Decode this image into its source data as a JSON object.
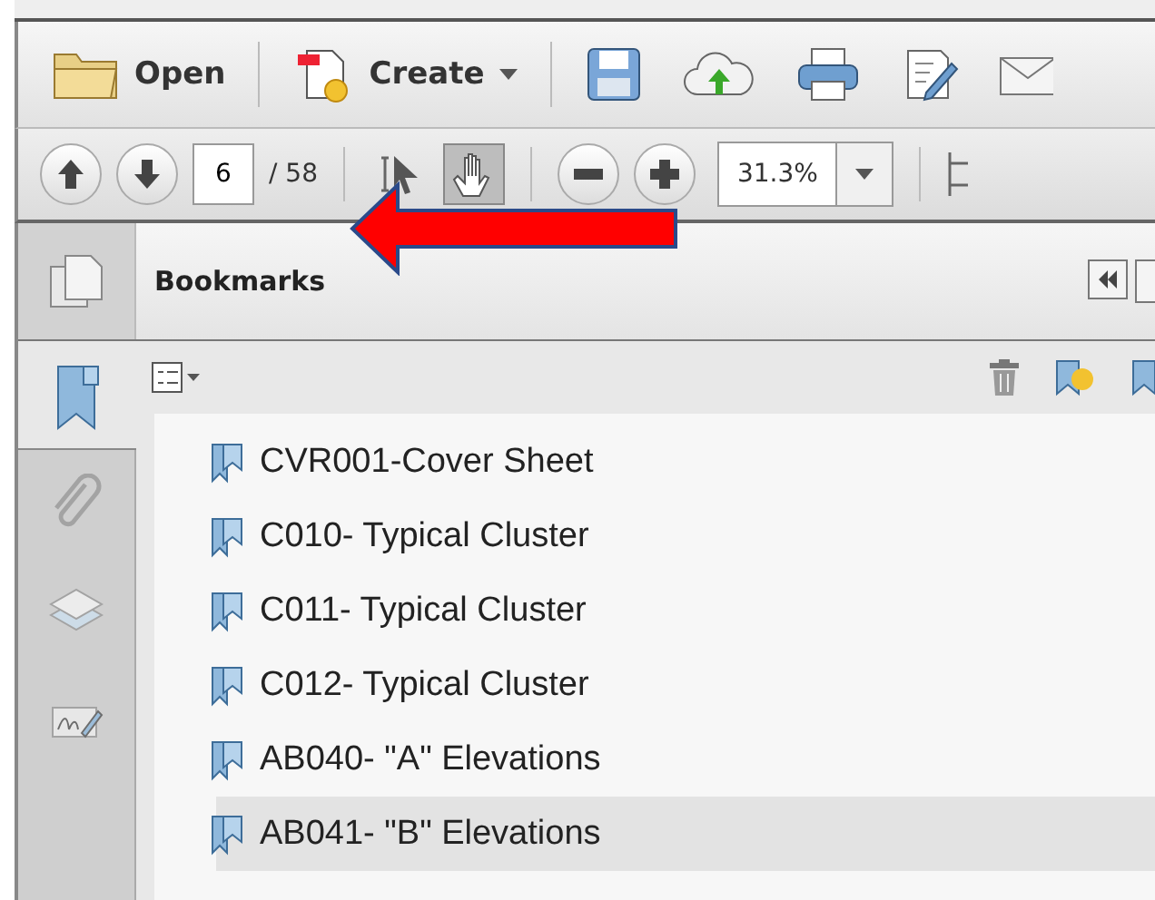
{
  "toolbar": {
    "open_label": "Open",
    "create_label": "Create"
  },
  "navigation": {
    "page_number": "6",
    "page_total": "/ 58",
    "zoom": "31.3%",
    "hand_tool_selected": true
  },
  "panel": {
    "title": "Bookmarks",
    "side_tabs": [
      {
        "kind": "bookmarks",
        "selected": true
      },
      {
        "kind": "attachments",
        "selected": false
      },
      {
        "kind": "layers",
        "selected": false
      },
      {
        "kind": "signatures",
        "selected": false
      }
    ],
    "bookmarks": [
      {
        "label": "CVR001-Cover Sheet",
        "selected": false
      },
      {
        "label": "C010- Typical Cluster",
        "selected": false
      },
      {
        "label": "C011- Typical Cluster",
        "selected": false
      },
      {
        "label": "C012- Typical Cluster",
        "selected": false
      },
      {
        "label": "AB040- \"A\" Elevations",
        "selected": false
      },
      {
        "label": "AB041- \"B\" Elevations",
        "selected": true
      }
    ]
  }
}
